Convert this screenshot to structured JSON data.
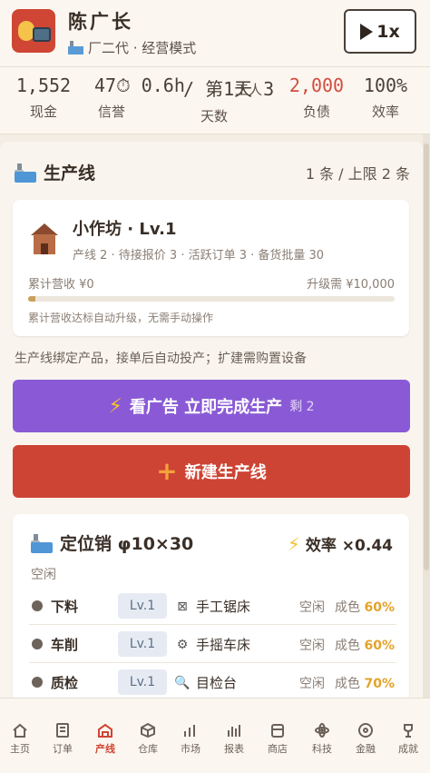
{
  "player": {
    "name": "陈广长",
    "subtitle": "厂二代 · 经营模式",
    "speed_label": "1x"
  },
  "stats": [
    {
      "value": "1,552",
      "label": "现金",
      "color": "#4a3f37"
    },
    {
      "value": "47⏱ 0.6h",
      "label": "信誉",
      "color": "#4a3f37"
    },
    {
      "value": "/ 第1天 3",
      "label": "天数",
      "color": "#4a3f37"
    },
    {
      "value": "",
      "label": "工人",
      "color": "#4a3f37"
    },
    {
      "value": "2,000",
      "label": "负债",
      "color": "#d24c3f"
    },
    {
      "value": "100%",
      "label": "效率",
      "color": "#4a3f37"
    }
  ],
  "section": {
    "title": "生产线",
    "count": "1 条 / 上限 2 条"
  },
  "workshop": {
    "title": "小作坊 · Lv.1",
    "meta": "产线 2 · 待接报价 3 · 活跃订单 3 · 备货批量 30",
    "revenue": "累计营收 ¥0",
    "upgrade": "升级需 ¥10,000",
    "progress": 0.02,
    "note": "累计营收达标自动升级，无需手动操作"
  },
  "hint": "生产线绑定产品，接单后自动投产；扩建需购置设备",
  "ad_button": {
    "label": "看广告 立即完成生产",
    "remaining": "剩 2"
  },
  "new_button": {
    "label": "新建生产线"
  },
  "line": {
    "title": "定位销 φ10×30",
    "efficiency": "效率 ×0.44",
    "status": "空闲",
    "steps": [
      {
        "name": "下料",
        "level": "Lv.1",
        "tool_icon": "⊠",
        "tool": "手工锯床",
        "state": "空闲",
        "quality_label": "成色",
        "quality": "60%"
      },
      {
        "name": "车削",
        "level": "Lv.1",
        "tool_icon": "⚙",
        "tool": "手摇车床",
        "state": "空闲",
        "quality_label": "成色",
        "quality": "60%"
      },
      {
        "name": "质检",
        "level": "Lv.1",
        "tool_icon": "🔍",
        "tool": "目检台",
        "state": "空闲",
        "quality_label": "成色",
        "quality": "70%"
      }
    ]
  },
  "tabs": [
    {
      "label": "主页",
      "icon": "home-icon"
    },
    {
      "label": "订单",
      "icon": "order-icon"
    },
    {
      "label": "产线",
      "icon": "factory-icon",
      "active": true
    },
    {
      "label": "仓库",
      "icon": "warehouse-icon"
    },
    {
      "label": "市场",
      "icon": "market-icon"
    },
    {
      "label": "报表",
      "icon": "report-icon"
    },
    {
      "label": "商店",
      "icon": "shop-icon"
    },
    {
      "label": "科技",
      "icon": "tech-icon"
    },
    {
      "label": "金融",
      "icon": "finance-icon"
    },
    {
      "label": "成就",
      "icon": "trophy-icon"
    }
  ]
}
